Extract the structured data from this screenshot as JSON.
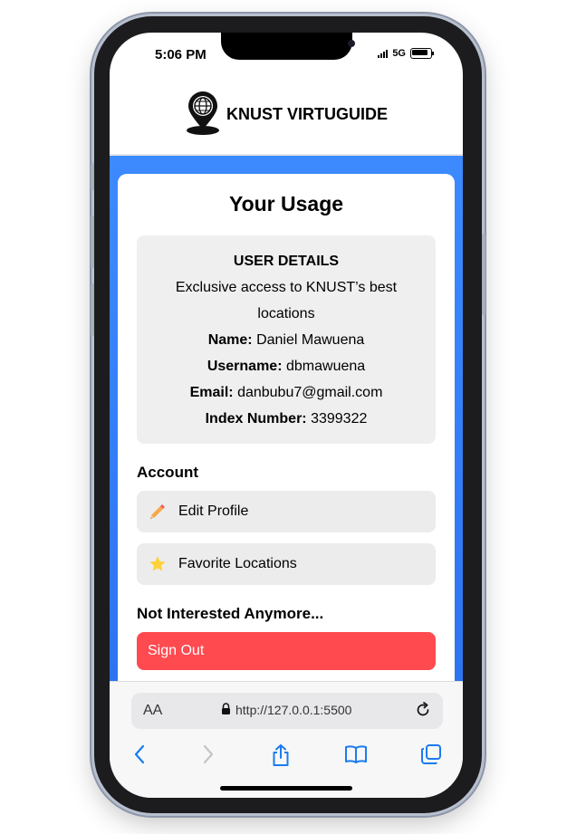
{
  "status_bar": {
    "time": "5:06 PM",
    "network": "5G"
  },
  "app": {
    "title": "KNUST VIRTUGUIDE",
    "logo_icon": "globe-location-pin-icon"
  },
  "usage": {
    "heading": "Your Usage",
    "details": {
      "title": "USER DETAILS",
      "tagline": "Exclusive access to KNUST’s best locations",
      "name_label": "Name:",
      "name_value": "Daniel Mawuena",
      "username_label": "Username:",
      "username_value": "dbmawuena",
      "email_label": "Email:",
      "email_value": "danbubu7@gmail.com",
      "index_label": "Index Number:",
      "index_value": "3399322"
    }
  },
  "account": {
    "title": "Account",
    "edit_profile_label": "Edit Profile",
    "edit_profile_icon": "pencil-icon",
    "favorites_label": "Favorite Locations",
    "favorites_icon": "star-icon"
  },
  "not_interested": {
    "title": "Not Interested Anymore...",
    "sign_out_label": "Sign Out"
  },
  "browser": {
    "aa_label": "AA",
    "url": "http://127.0.0.1:5500"
  },
  "colors": {
    "accent_blue": "#3d8aff",
    "sign_out_red": "#ff4a50",
    "card_gray": "#efefef",
    "ios_blue": "#1a7cf0"
  }
}
